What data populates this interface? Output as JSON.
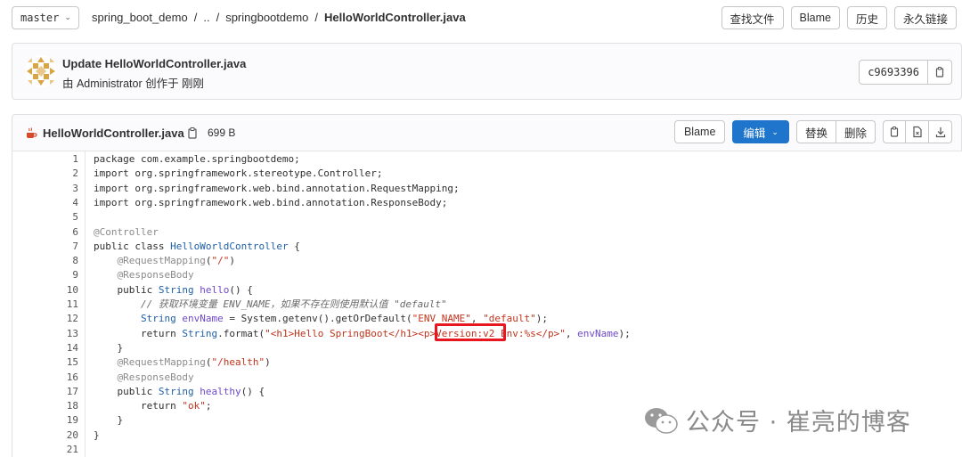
{
  "toolbar": {
    "branch": "master",
    "breadcrumb": [
      "spring_boot_demo",
      "..",
      "springbootdemo",
      "HelloWorldController.java"
    ],
    "buttons": [
      "查找文件",
      "Blame",
      "历史",
      "永久链接"
    ]
  },
  "commit": {
    "title": "Update HelloWorldController.java",
    "meta": "由 Administrator 创作于 刚刚",
    "sha": "c9693396"
  },
  "file": {
    "name": "HelloWorldController.java",
    "size": "699 B",
    "blame_label": "Blame",
    "edit_label": "编辑",
    "replace_label": "替换",
    "delete_label": "删除"
  },
  "code": {
    "line_numbers": [
      "1",
      "2",
      "3",
      "4",
      "5",
      "6",
      "7",
      "8",
      "9",
      "10",
      "11",
      "12",
      "13",
      "14",
      "15",
      "16",
      "17",
      "18",
      "19",
      "20",
      "21"
    ],
    "lines": [
      "package com.example.springbootdemo;",
      "import org.springframework.stereotype.Controller;",
      "import org.springframework.web.bind.annotation.RequestMapping;",
      "import org.springframework.web.bind.annotation.ResponseBody;",
      "",
      "@Controller",
      "public class HelloWorldController {",
      "    @RequestMapping(\"/\")",
      "    @ResponseBody",
      "    public String hello() {",
      "        // 获取环境变量 ENV_NAME，如果不存在则使用默认值 \"default\"",
      "        String envName = System.getenv().getOrDefault(\"ENV_NAME\", \"default\");",
      "        return String.format(\"<h1>Hello SpringBoot</h1><p>Version:v2 Env:%s</p>\", envName);",
      "    }",
      "    @RequestMapping(\"/health\")",
      "    @ResponseBody",
      "    public String healthy() {",
      "        return \"ok\";",
      "    }",
      "}",
      ""
    ]
  },
  "watermark": {
    "text": "公众号 · 崔亮的博客"
  },
  "colors": {
    "primary": "#1f75cb",
    "highlight": "#e8161e"
  }
}
